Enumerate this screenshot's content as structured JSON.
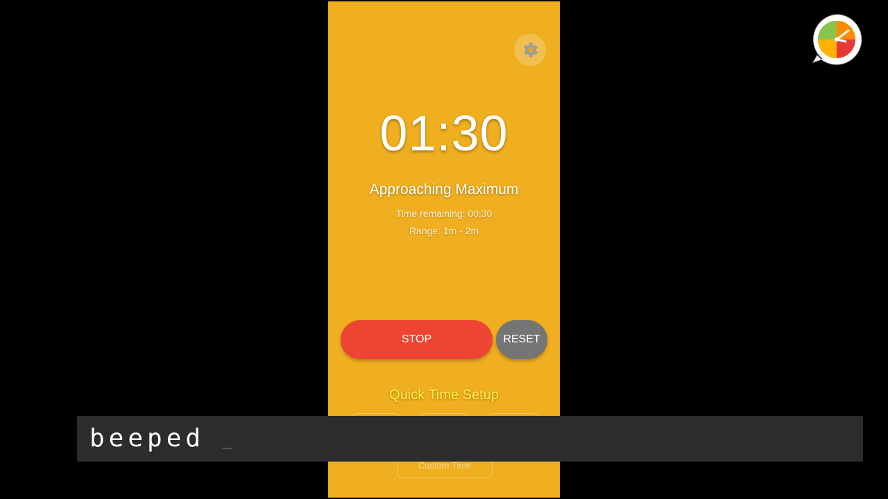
{
  "app": {
    "timer_display": "01:30",
    "status": "Approaching Maximum",
    "time_remaining": "Time remaining: 00:30",
    "range": "Range: 1m - 2m",
    "stop_label": "STOP",
    "reset_label": "RESET",
    "quick_setup_title": "Quick Time Setup",
    "custom_time_label": "Custom Time",
    "background_color": "#efaf20",
    "stop_color": "#ee4433",
    "reset_color": "#757575",
    "settings_icon": "gear-icon"
  },
  "overlay": {
    "subtitle": "beeped"
  },
  "logo": {
    "icon": "timer-logo-icon"
  }
}
